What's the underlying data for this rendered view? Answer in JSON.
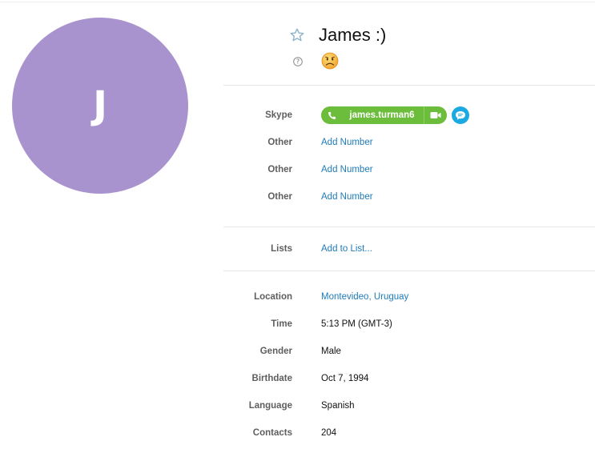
{
  "profile": {
    "avatar_initial": "J",
    "display_name": "James :)",
    "mood_icon": "sad-face-emoticon",
    "avatar_color": "#a993cf"
  },
  "skype": {
    "label": "Skype",
    "username": "james.turman6",
    "pill_color": "#6cbd3b",
    "chat_color": "#1ba9e1"
  },
  "phones": [
    {
      "label": "Other",
      "value": "Add Number"
    },
    {
      "label": "Other",
      "value": "Add Number"
    },
    {
      "label": "Other",
      "value": "Add Number"
    }
  ],
  "lists": {
    "label": "Lists",
    "value": "Add to List..."
  },
  "details": {
    "location": {
      "label": "Location",
      "value": "Montevideo, Uruguay"
    },
    "time": {
      "label": "Time",
      "value": "5:13 PM (GMT-3)"
    },
    "gender": {
      "label": "Gender",
      "value": "Male"
    },
    "birthdate": {
      "label": "Birthdate",
      "value": "Oct 7, 1994"
    },
    "language": {
      "label": "Language",
      "value": "Spanish"
    },
    "contacts": {
      "label": "Contacts",
      "value": "204"
    }
  },
  "link_color": "#1e7bb8"
}
